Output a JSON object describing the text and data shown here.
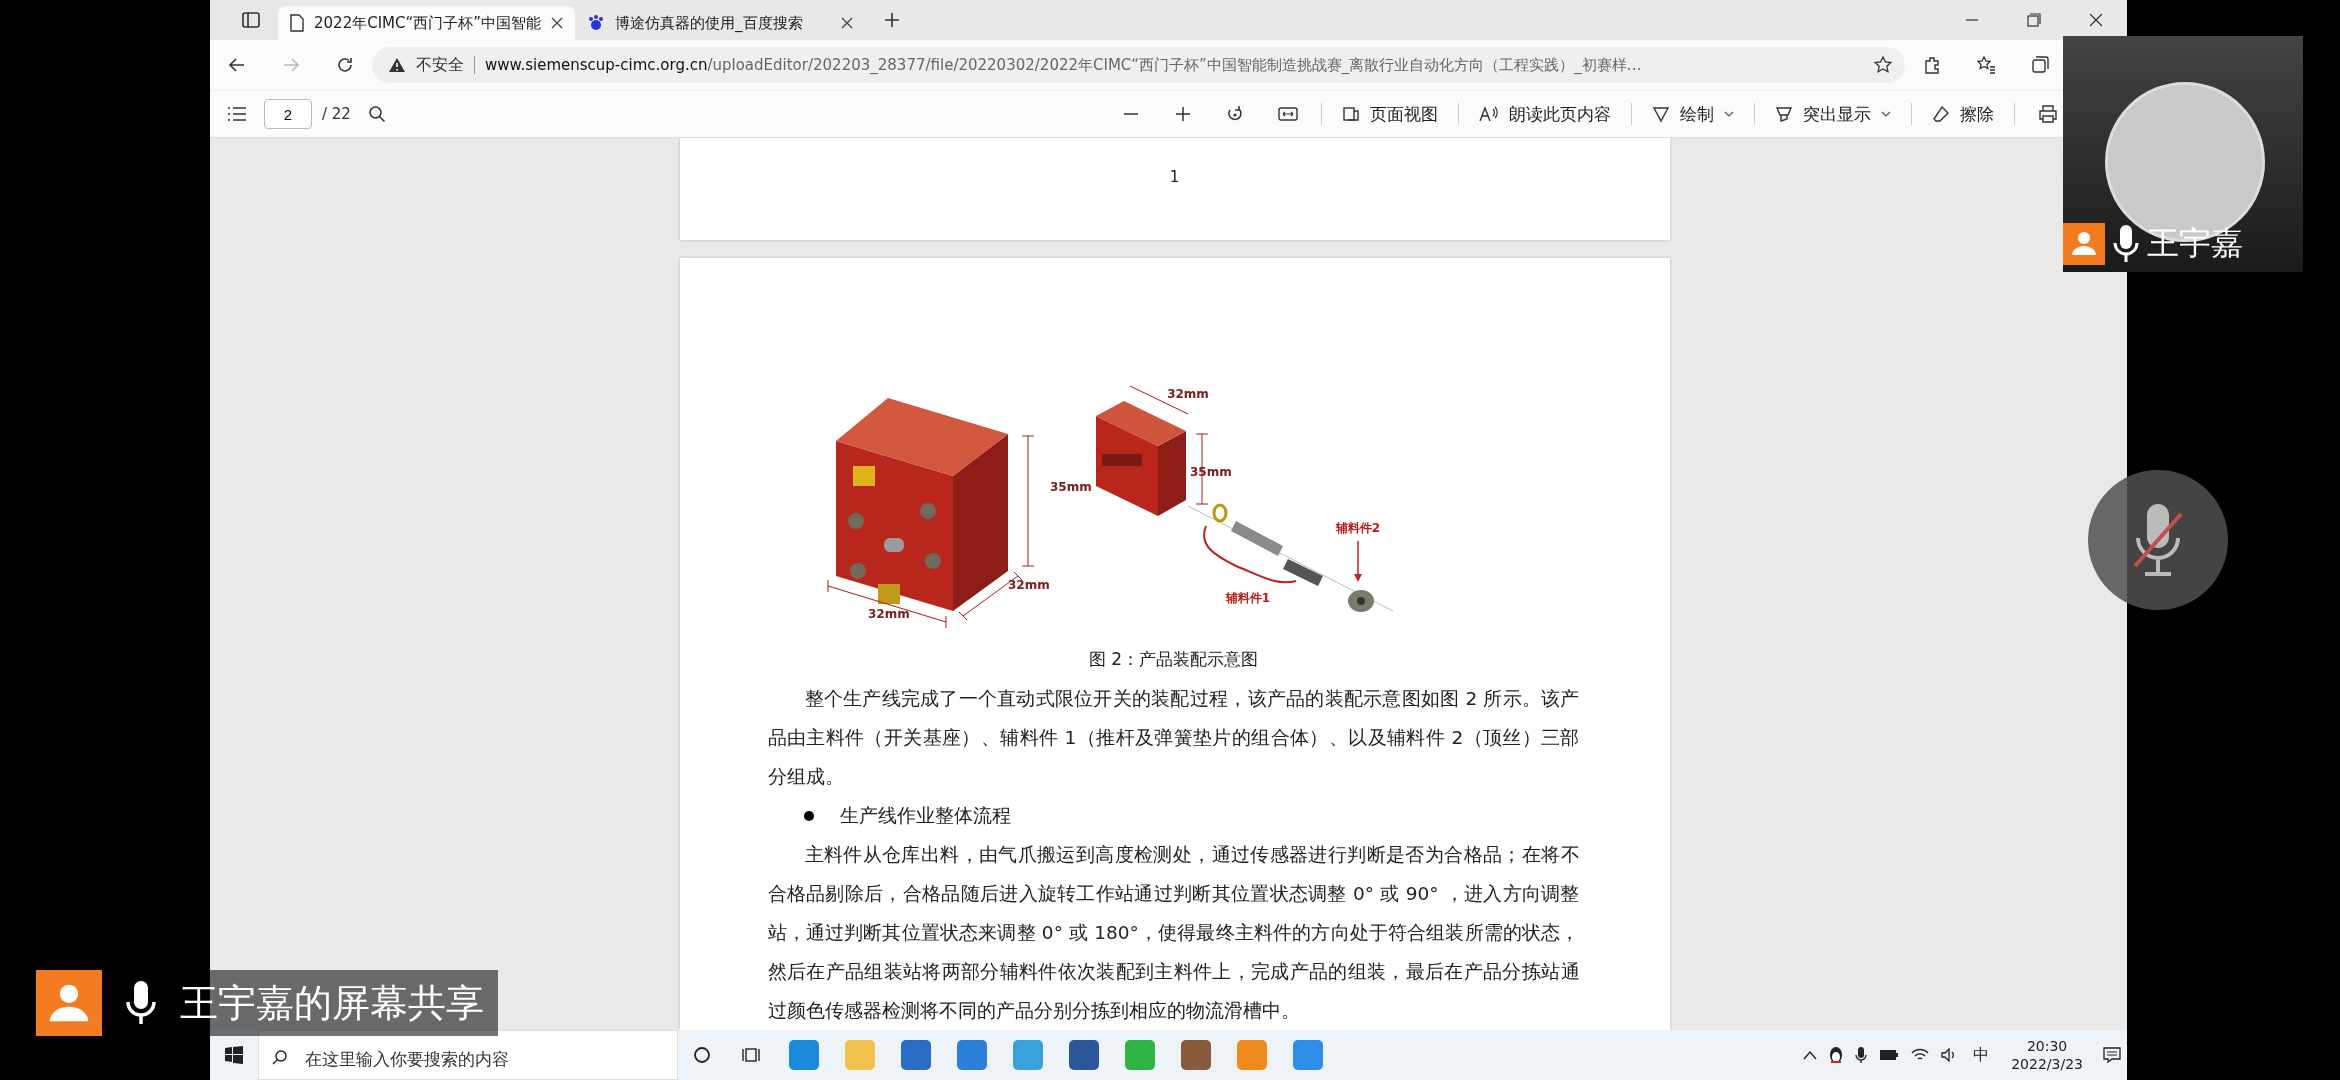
{
  "browser": {
    "tabs": [
      {
        "title": "2022年CIMC“西门子杯”中国智能",
        "selected": true,
        "kind": "doc"
      },
      {
        "title": "博途仿真器的使用_百度搜索",
        "selected": false,
        "kind": "search"
      }
    ],
    "security_label": "不安全",
    "url_host": "www.siemenscup-cimc.org.cn",
    "url_path": "/uploadEditor/202203_28377/file/20220302/2022年CIMC“西门子杯”中国智能制造挑战赛_离散行业自动化方向（工程实践）_初赛样..."
  },
  "pdf_toolbar": {
    "page": "2",
    "page_total": "/ 22",
    "tools": [
      {
        "kind": "view",
        "label": "页面视图"
      },
      {
        "kind": "read",
        "label": "朗读此页内容"
      },
      {
        "kind": "draw",
        "label": "绘制"
      },
      {
        "kind": "highlight",
        "label": "突出显示"
      },
      {
        "kind": "erase",
        "label": "擦除"
      }
    ]
  },
  "document": {
    "page_number": "1",
    "figure": {
      "labels": [
        {
          "kind": "base_height",
          "text": "35mm"
        },
        {
          "kind": "base_depth",
          "text": "32mm"
        },
        {
          "kind": "base_width",
          "text": "32mm"
        },
        {
          "kind": "part_width",
          "text": "32mm"
        },
        {
          "kind": "part_height",
          "text": "35mm"
        },
        {
          "kind": "aux2",
          "text": "辅料件2"
        },
        {
          "kind": "aux1",
          "text": "辅料件1"
        }
      ],
      "caption": "图 2：产品装配示意图"
    },
    "blocks": [
      {
        "kind": "paragraph",
        "text": "整个生产线完成了一个直动式限位开关的装配过程，该产品的装配示意图如图 2 所示。该产品由主料件（开关基座）、辅料件 1（推杆及弹簧垫片的组合体）、以及辅料件 2（顶丝）三部分组成。"
      },
      {
        "kind": "bullet",
        "text": "生产线作业整体流程"
      },
      {
        "kind": "paragraph",
        "text": "主料件从仓库出料，由气爪搬运到高度检测处，通过传感器进行判断是否为合格品；在将不合格品剔除后，合格品随后进入旋转工作站通过判断其位置状态调整 0° 或 90° ，进入方向调整站，通过判断其位置状态来调整 0° 或 180°，使得最终主料件的方向处于符合组装所需的状态，然后在产品组装站将两部分辅料件依次装配到主料件上，完成产品的组装，最后在产品分拣站通过颜色传感器检测将不同的产品分别分拣到相应的物流滑槽中。"
      }
    ]
  },
  "taskbar": {
    "search_placeholder": "在这里输入你要搜索的内容",
    "apps": [
      {
        "kind": "edge"
      },
      {
        "kind": "folder"
      },
      {
        "kind": "store"
      },
      {
        "kind": "mail"
      },
      {
        "kind": "meeting"
      },
      {
        "kind": "word"
      },
      {
        "kind": "wechat"
      },
      {
        "kind": "game"
      },
      {
        "kind": "vm"
      },
      {
        "kind": "board"
      }
    ],
    "ime": "中",
    "time": "20:30",
    "date": "2022/3/23"
  },
  "participant": {
    "name": "王宇嘉"
  },
  "mic_button": {
    "muted": true
  },
  "share_label": {
    "text": "王宇嘉的屏幕共享"
  }
}
